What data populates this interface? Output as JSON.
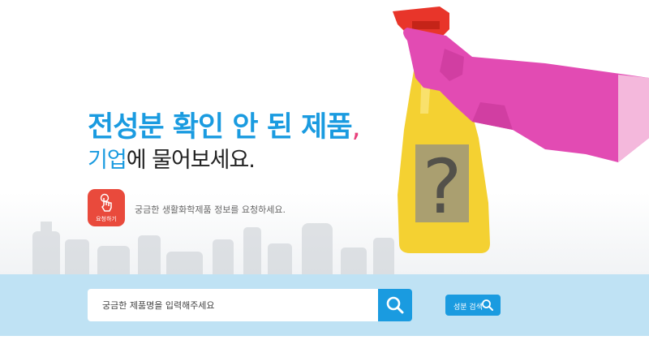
{
  "hero": {
    "headline_main": "전성분 확인 안 된 제품",
    "headline_comma": ",",
    "subline_highlight": "기업",
    "subline_rest": "에 물어보세요.",
    "request_button_label": "요청하기",
    "request_text": "궁금한 생활화학제품 정보를 요청하세요."
  },
  "search": {
    "placeholder": "궁금한 제품명을 입력해주세요",
    "ingredient_search_label": "성분 검색"
  },
  "icons": {
    "search": "search-icon",
    "request": "hand-tap-icon"
  },
  "colors": {
    "accent": "#1a9be0",
    "request_button": "#e94a3c",
    "search_band": "#bfe2f4",
    "glove": "#e24bb3",
    "bottle": "#f4d132",
    "trigger": "#e8352a"
  }
}
